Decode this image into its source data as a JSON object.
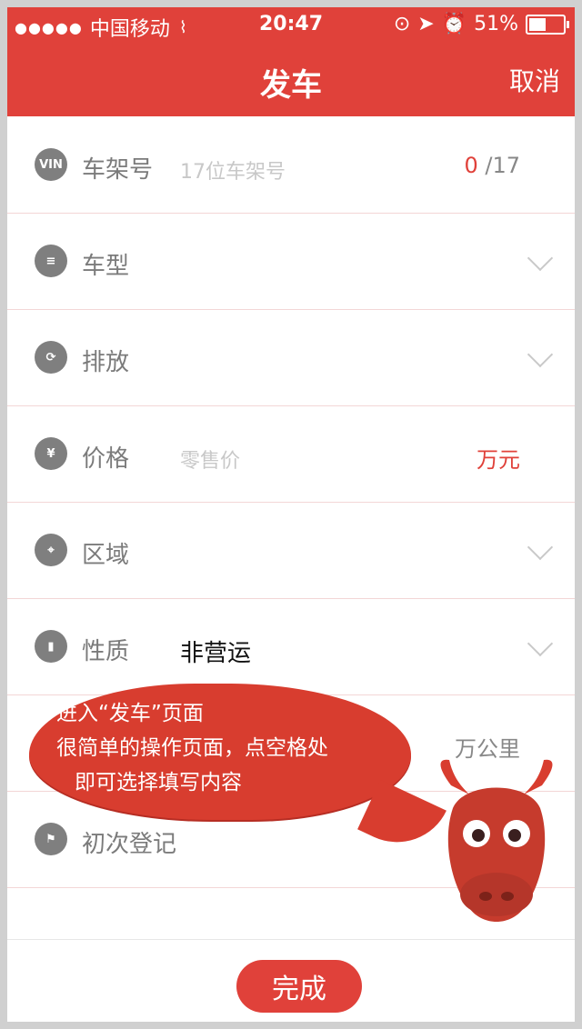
{
  "status": {
    "carrier": "中国移动",
    "time": "20:47",
    "battery_percent": "51%",
    "battery_fraction": 0.51
  },
  "header": {
    "title": "发车",
    "cancel_label": "取消"
  },
  "form": {
    "vin": {
      "icon": "vin-icon",
      "label": "车架号",
      "placeholder": "17位车架号",
      "count_current": "0",
      "count_total": "/17"
    },
    "model": {
      "icon": "list-icon",
      "label": "车型"
    },
    "emission": {
      "icon": "refresh-icon",
      "label": "排放"
    },
    "price": {
      "icon": "yuan-icon",
      "label": "价格",
      "placeholder": "零售价",
      "unit": "万元"
    },
    "region": {
      "icon": "location-pin-icon",
      "label": "区域"
    },
    "nature": {
      "icon": "bookmark-icon",
      "label": "性质",
      "value": "非营运"
    },
    "mileage": {
      "unit": "万公里"
    },
    "first_registration": {
      "icon": "flag-icon",
      "label": "初次登记"
    }
  },
  "tooltip": {
    "line1": "进入“发车”页面",
    "line2": "很简单的操作页面，点空格处",
    "line3": "即可选择填写内容"
  },
  "footer": {
    "done_label": "完成"
  }
}
